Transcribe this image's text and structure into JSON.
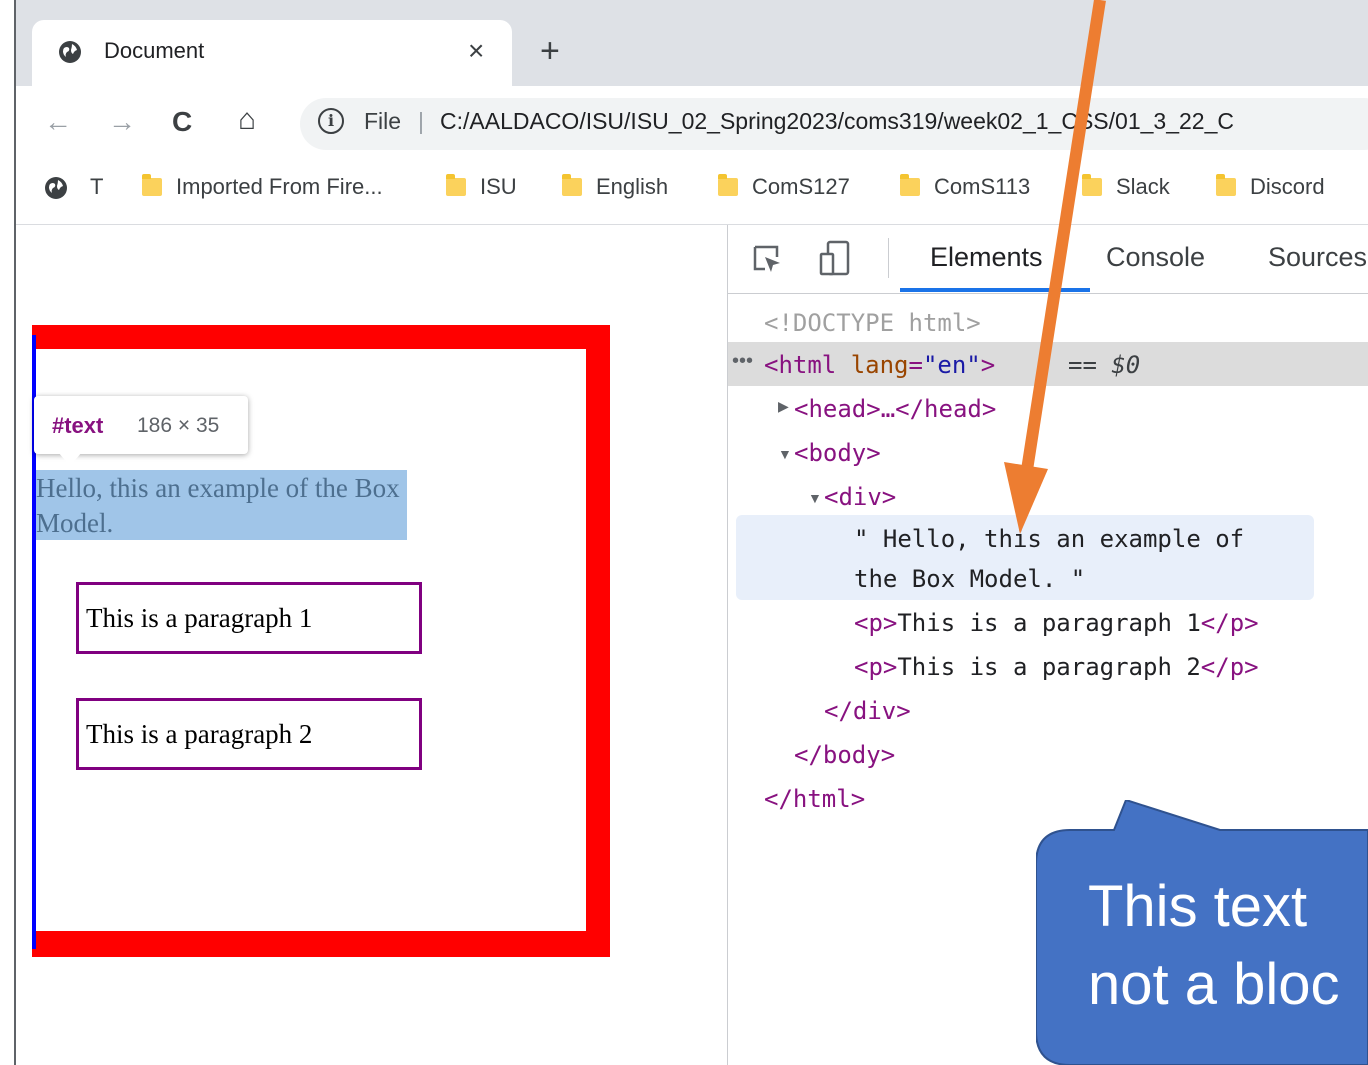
{
  "browser": {
    "tab": {
      "title": "Document",
      "close": "×",
      "new_tab": "+"
    },
    "nav": {
      "back": "←",
      "forward": "→",
      "reload": "C",
      "home": "⌂"
    },
    "omnibox": {
      "info": "i",
      "scheme": "File",
      "separator": "|",
      "url": "C:/AALDACO/ISU/ISU_02_Spring2023/coms319/week02_1_CSS/01_3_22_C"
    },
    "bookmarks": [
      {
        "label": "T",
        "icon": "globe-icon"
      },
      {
        "label": "Imported From Fire...",
        "icon": "folder-icon"
      },
      {
        "label": "ISU",
        "icon": "folder-icon"
      },
      {
        "label": "English",
        "icon": "folder-icon"
      },
      {
        "label": "ComS127",
        "icon": "folder-icon"
      },
      {
        "label": "ComS113",
        "icon": "folder-icon"
      },
      {
        "label": "Slack",
        "icon": "folder-icon"
      },
      {
        "label": "Discord",
        "icon": "folder-icon"
      }
    ]
  },
  "page": {
    "tooltip": {
      "name": "#text",
      "size": "186 × 35"
    },
    "text_node": "Hello, this an example of the Box Model.",
    "paragraphs": [
      "This is a paragraph 1",
      "This is a paragraph 2"
    ],
    "colors": {
      "outer_border": "#ff0000",
      "left_border": "#0000ff",
      "paragraph_border": "#800080",
      "highlight": "#a0c5e8"
    }
  },
  "devtools": {
    "tabs": [
      "Elements",
      "Console",
      "Sources"
    ],
    "active_tab": "Elements",
    "dom": {
      "doctype": "<!DOCTYPE html>",
      "html_open": "<html",
      "html_attr": "lang",
      "html_attr_eq": "=",
      "html_attr_val": "\"en\"",
      "html_close_bracket": ">",
      "selected_marker": "== $0",
      "head": "<head>…</head>",
      "body_open": "<body>",
      "div_open": "<div>",
      "text_line1": "\" Hello, this an example of",
      "text_line2": "the Box Model. \"",
      "p1_open": "<p>",
      "p1_text": "This is a paragraph 1",
      "p1_close": "</p>",
      "p2_open": "<p>",
      "p2_text": "This is a paragraph 2",
      "p2_close": "</p>",
      "div_close": "</div>",
      "body_close": "</body>",
      "html_close": "</html>"
    }
  },
  "callout": {
    "line1": "This text",
    "line2": "not a bloc",
    "color": "#4472c4",
    "arrow_color": "#ed7d31"
  }
}
